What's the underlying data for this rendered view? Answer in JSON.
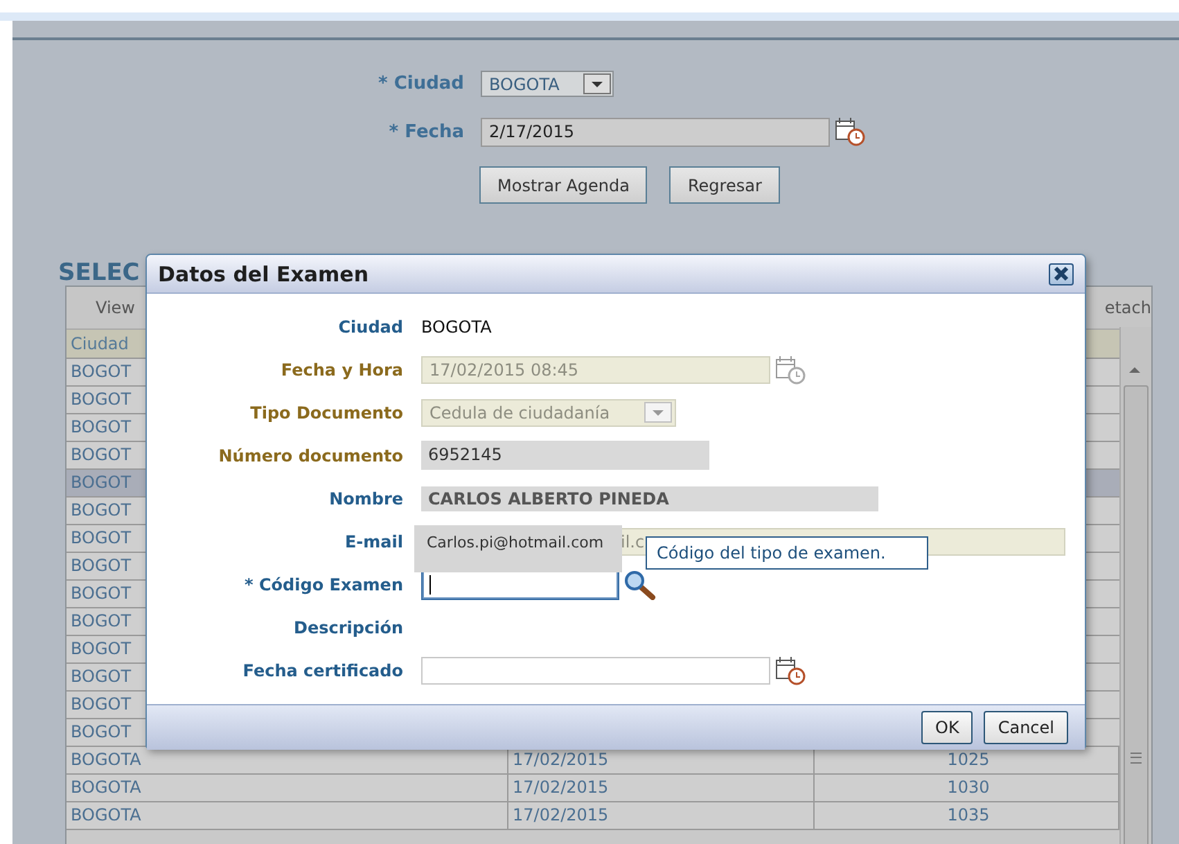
{
  "search_form": {
    "ciudad_label": "* Ciudad",
    "ciudad_value": "BOGOTA",
    "fecha_label": "* Fecha",
    "fecha_value": "2/17/2015",
    "buttons": [
      "Mostrar Agenda",
      "Regresar"
    ]
  },
  "section_title": "SELEC",
  "table": {
    "toolbar": [
      "View",
      "etach"
    ],
    "columns": [
      "Ciudad"
    ],
    "rows": [
      {
        "cells": [
          "BOGOT"
        ],
        "selected": false
      },
      {
        "cells": [
          "BOGOT"
        ],
        "selected": false
      },
      {
        "cells": [
          "BOGOT"
        ],
        "selected": false
      },
      {
        "cells": [
          "BOGOT"
        ],
        "selected": false
      },
      {
        "cells": [
          "BOGOT"
        ],
        "selected": true
      },
      {
        "cells": [
          "BOGOT"
        ],
        "selected": false
      },
      {
        "cells": [
          "BOGOT"
        ],
        "selected": false
      },
      {
        "cells": [
          "BOGOT"
        ],
        "selected": false
      },
      {
        "cells": [
          "BOGOT"
        ],
        "selected": false
      },
      {
        "cells": [
          "BOGOT"
        ],
        "selected": false
      },
      {
        "cells": [
          "BOGOT"
        ],
        "selected": false
      },
      {
        "cells": [
          "BOGOT"
        ],
        "selected": false
      },
      {
        "cells": [
          "BOGOT"
        ],
        "selected": false
      },
      {
        "cells": [
          "BOGOT"
        ],
        "selected": false
      },
      {
        "cells": [
          "BOGOTA",
          "17/02/2015",
          "1025"
        ],
        "selected": false
      },
      {
        "cells": [
          "BOGOTA",
          "17/02/2015",
          "1030"
        ],
        "selected": false
      },
      {
        "cells": [
          "BOGOTA",
          "17/02/2015",
          "1035"
        ],
        "selected": false
      }
    ]
  },
  "dialog": {
    "title": "Datos del Examen",
    "fields": [
      {
        "kind": "text",
        "label": "Ciudad",
        "value": "BOGOTA",
        "disabled": false
      },
      {
        "kind": "date",
        "label": "Fecha y Hora",
        "value": "17/02/2015 08:45",
        "disabled": true
      },
      {
        "kind": "select",
        "label": "Tipo Documento",
        "value": "Cedula de ciudadanía",
        "disabled": true
      },
      {
        "kind": "readonly",
        "label": "Número documento",
        "value": "6952145",
        "disabled": true
      },
      {
        "kind": "name",
        "label": "Nombre",
        "value": "CARLOS ALBERTO PINEDA",
        "disabled": false
      },
      {
        "kind": "email",
        "label": "E-mail",
        "value": "il.c",
        "disabled": false
      },
      {
        "kind": "lookup",
        "label": "* Código Examen",
        "disabled": false,
        "focused": true
      },
      {
        "kind": "label",
        "label": "Descripción",
        "disabled": false
      },
      {
        "kind": "date",
        "label": "Fecha certificado",
        "disabled": false
      }
    ],
    "email_suggestion": "Carlos.pi@hotmail.com",
    "tooltip": "Código del tipo de examen.",
    "buttons": [
      "OK",
      "Cancel"
    ]
  }
}
